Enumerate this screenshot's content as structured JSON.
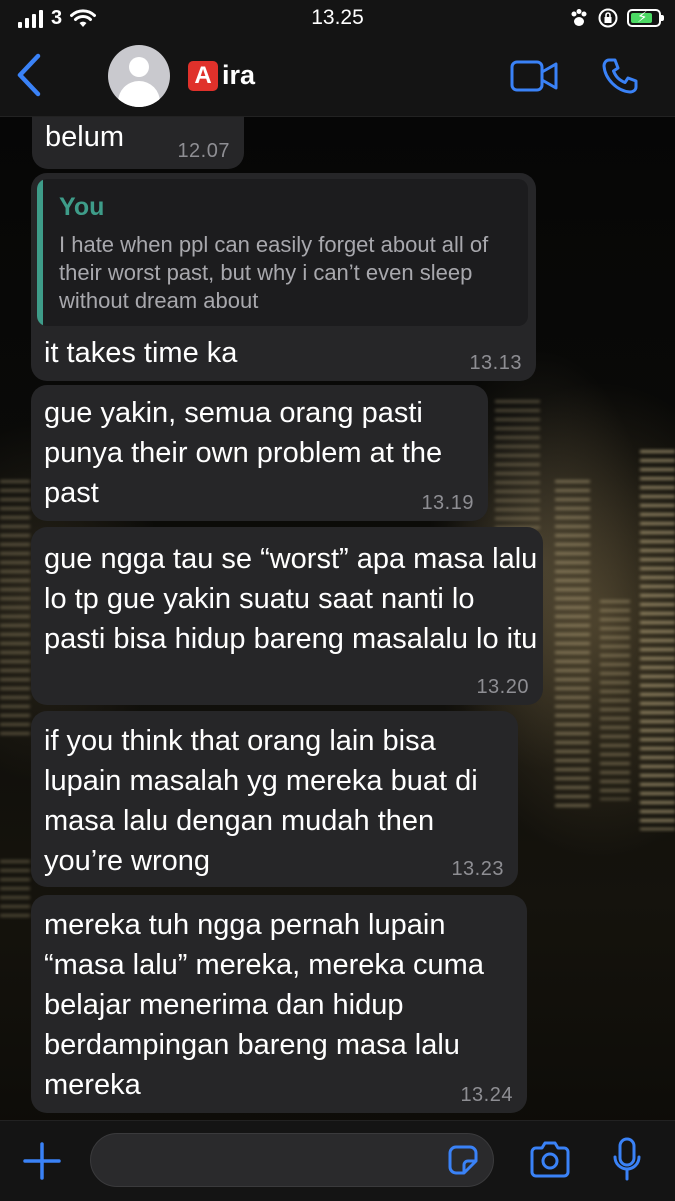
{
  "status_bar": {
    "carrier": "3",
    "time": "13.25",
    "battery_level": 0.8,
    "icons": [
      "signal-icon",
      "wifi-icon",
      "paw-icon",
      "orientation-lock-icon",
      "battery-icon"
    ]
  },
  "header": {
    "contact_badge": "A",
    "contact_name": "ira",
    "icons": [
      "back-icon",
      "avatar-icon",
      "video-call-icon",
      "phone-icon"
    ]
  },
  "messages": [
    {
      "text": "belum",
      "time": "12.07"
    },
    {
      "quote": {
        "author": "You",
        "text": "I hate when ppl can easily forget about all of their worst past, but why i can’t even sleep without dream about"
      },
      "text": "it takes time ka",
      "time": "13.13"
    },
    {
      "text": "gue yakin, semua orang pasti punya their own problem at the past",
      "time": "13.19"
    },
    {
      "text": "gue ngga tau se “worst” apa masa lalu lo tp gue yakin suatu saat nanti lo pasti bisa hidup bareng masalalu lo itu",
      "time": "13.20"
    },
    {
      "text": "if you think that orang lain bisa lupain masalah yg mereka buat di masa lalu dengan mudah then you’re wrong",
      "time": "13.23"
    },
    {
      "text": "mereka tuh ngga pernah lupain “masa lalu” mereka, mereka cuma belajar menerima dan hidup berdampingan bareng masa lalu mereka",
      "time": "13.24"
    }
  ],
  "input_bar": {
    "placeholder": "",
    "icons": [
      "plus-icon",
      "sticker-icon",
      "camera-icon",
      "microphone-icon"
    ]
  },
  "colors": {
    "accent": "#3a82f7",
    "bubble": "#262628",
    "quote_accent": "#3e9c89",
    "timestamp": "#8e8e93",
    "badge": "#e0312b"
  }
}
